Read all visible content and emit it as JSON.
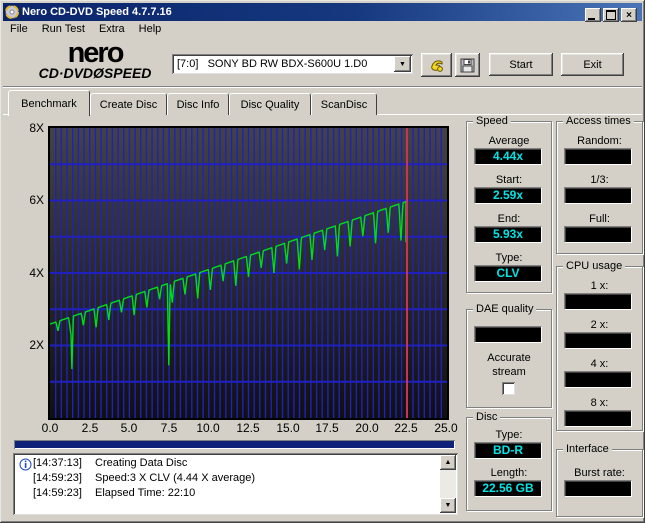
{
  "window": {
    "title": "Nero CD-DVD Speed 4.7.7.16",
    "controls": {
      "close": "×"
    }
  },
  "menu": {
    "items": [
      "File",
      "Run Test",
      "Extra",
      "Help"
    ]
  },
  "toolbar": {
    "logo_line1": "nero",
    "logo_line2": "CD·DVDØSPEED",
    "drive_select": "[7:0]   SONY BD RW BDX-S600U 1.D0",
    "dropdown_arrow": "▼",
    "start_label": "Start",
    "exit_label": "Exit"
  },
  "tabs": {
    "items": [
      "Benchmark",
      "Create Disc",
      "Disc Info",
      "Disc Quality",
      "ScanDisc"
    ],
    "active": "Benchmark"
  },
  "chart_data": {
    "type": "line",
    "x_range": [
      0,
      25
    ],
    "y_range": [
      0,
      8
    ],
    "x_ticks": [
      "0.0",
      "2.5",
      "5.0",
      "7.5",
      "10.0",
      "12.5",
      "15.0",
      "17.5",
      "20.0",
      "22.5",
      "25.0"
    ],
    "y_ticks": [
      "8X",
      "6X",
      "4X",
      "2X"
    ],
    "grid": {
      "color": "#2020c0",
      "v_divisions": 70,
      "h_step": 1
    },
    "plot_bg_top": "#434343",
    "plot_bg_bottom": "#101010",
    "series": [
      {
        "name": "write-speed",
        "color": "#00dd1e",
        "start": {
          "x": 0,
          "speed": 2.59
        },
        "end": {
          "x": 22.42,
          "speed": 5.97
        },
        "dips": {
          "first_x": 0.5,
          "interval": 0.8,
          "half_width": 0.13,
          "depth_ratio": 0.14
        },
        "deep_dips": [
          {
            "x": 1.38,
            "speed": 1.35
          },
          {
            "x": 7.48,
            "speed": 1.45
          }
        ],
        "end_drop_speed": 4.85
      }
    ],
    "marker": {
      "x": 22.48,
      "color": "#cc3060"
    }
  },
  "panels": {
    "speed": {
      "legend": "Speed",
      "fields": [
        {
          "label": "Average",
          "value": "4.44x"
        },
        {
          "label": "Start:",
          "value": "2.59x"
        },
        {
          "label": "End:",
          "value": "5.93x"
        },
        {
          "label": "Type:",
          "value": "CLV"
        }
      ]
    },
    "access_times": {
      "legend": "Access times",
      "fields": [
        {
          "label": "Random:",
          "value": ""
        },
        {
          "label": "1/3:",
          "value": ""
        },
        {
          "label": "Full:",
          "value": ""
        }
      ]
    },
    "dae_quality": {
      "legend": "DAE quality",
      "display_value": "",
      "accurate_stream_line1": "Accurate",
      "accurate_stream_line2": "stream",
      "checkbox_checked": false
    },
    "cpu_usage": {
      "legend": "CPU usage",
      "fields": [
        {
          "label": "1 x:",
          "value": ""
        },
        {
          "label": "2 x:",
          "value": ""
        },
        {
          "label": "4 x:",
          "value": ""
        },
        {
          "label": "8 x:",
          "value": ""
        }
      ]
    },
    "disc": {
      "legend": "Disc",
      "fields": [
        {
          "label": "Type:",
          "value": "BD-R"
        },
        {
          "label": "Length:",
          "value": "22.56 GB"
        }
      ]
    },
    "interface": {
      "legend": "Interface",
      "fields": [
        {
          "label": "Burst rate:",
          "value": ""
        }
      ]
    }
  },
  "progress": {
    "percent": 100
  },
  "log": {
    "scroll_up": "▲",
    "scroll_down": "▼",
    "entries": [
      {
        "time": "[14:37:13]",
        "text": "Creating Data Disc"
      },
      {
        "time": "[14:59:23]",
        "text": "Speed:3 X CLV (4.44 X average)"
      },
      {
        "time": "[14:59:23]",
        "text": "Elapsed Time: 22:10"
      }
    ]
  }
}
